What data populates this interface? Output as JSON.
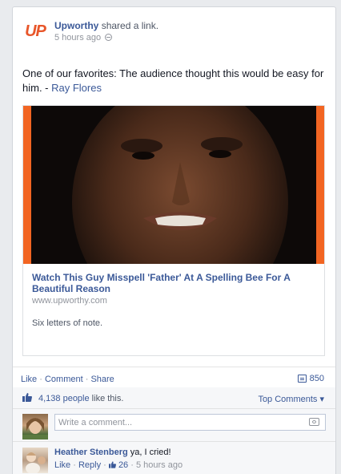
{
  "post": {
    "page_name": "Upworthy",
    "action": "shared a link.",
    "timestamp": "5 hours ago",
    "logo_text": "UP",
    "message": "One of our favorites: The audience thought this would be easy for him. - ",
    "mention": "Ray Flores"
  },
  "attachment": {
    "title": "Watch This Guy Misspell 'Father' At A Spelling Bee For A Beautiful Reason",
    "domain": "www.upworthy.com",
    "description": "Six letters of note."
  },
  "actions": {
    "like": "Like",
    "comment": "Comment",
    "share": "Share",
    "sep": " · ",
    "share_count": "850"
  },
  "likes": {
    "people": "4,138 people",
    "suffix": " like this.",
    "top_comments": "Top Comments ▾"
  },
  "composer": {
    "placeholder": "Write a comment..."
  },
  "comments": [
    {
      "author": "Heather Stenberg",
      "text": "ya, I cried!",
      "like": "Like",
      "reply": "Reply",
      "like_count": "26",
      "time": "5 hours ago"
    }
  ],
  "colors": {
    "link": "#3b5998",
    "brand_orange": "#f26522"
  }
}
